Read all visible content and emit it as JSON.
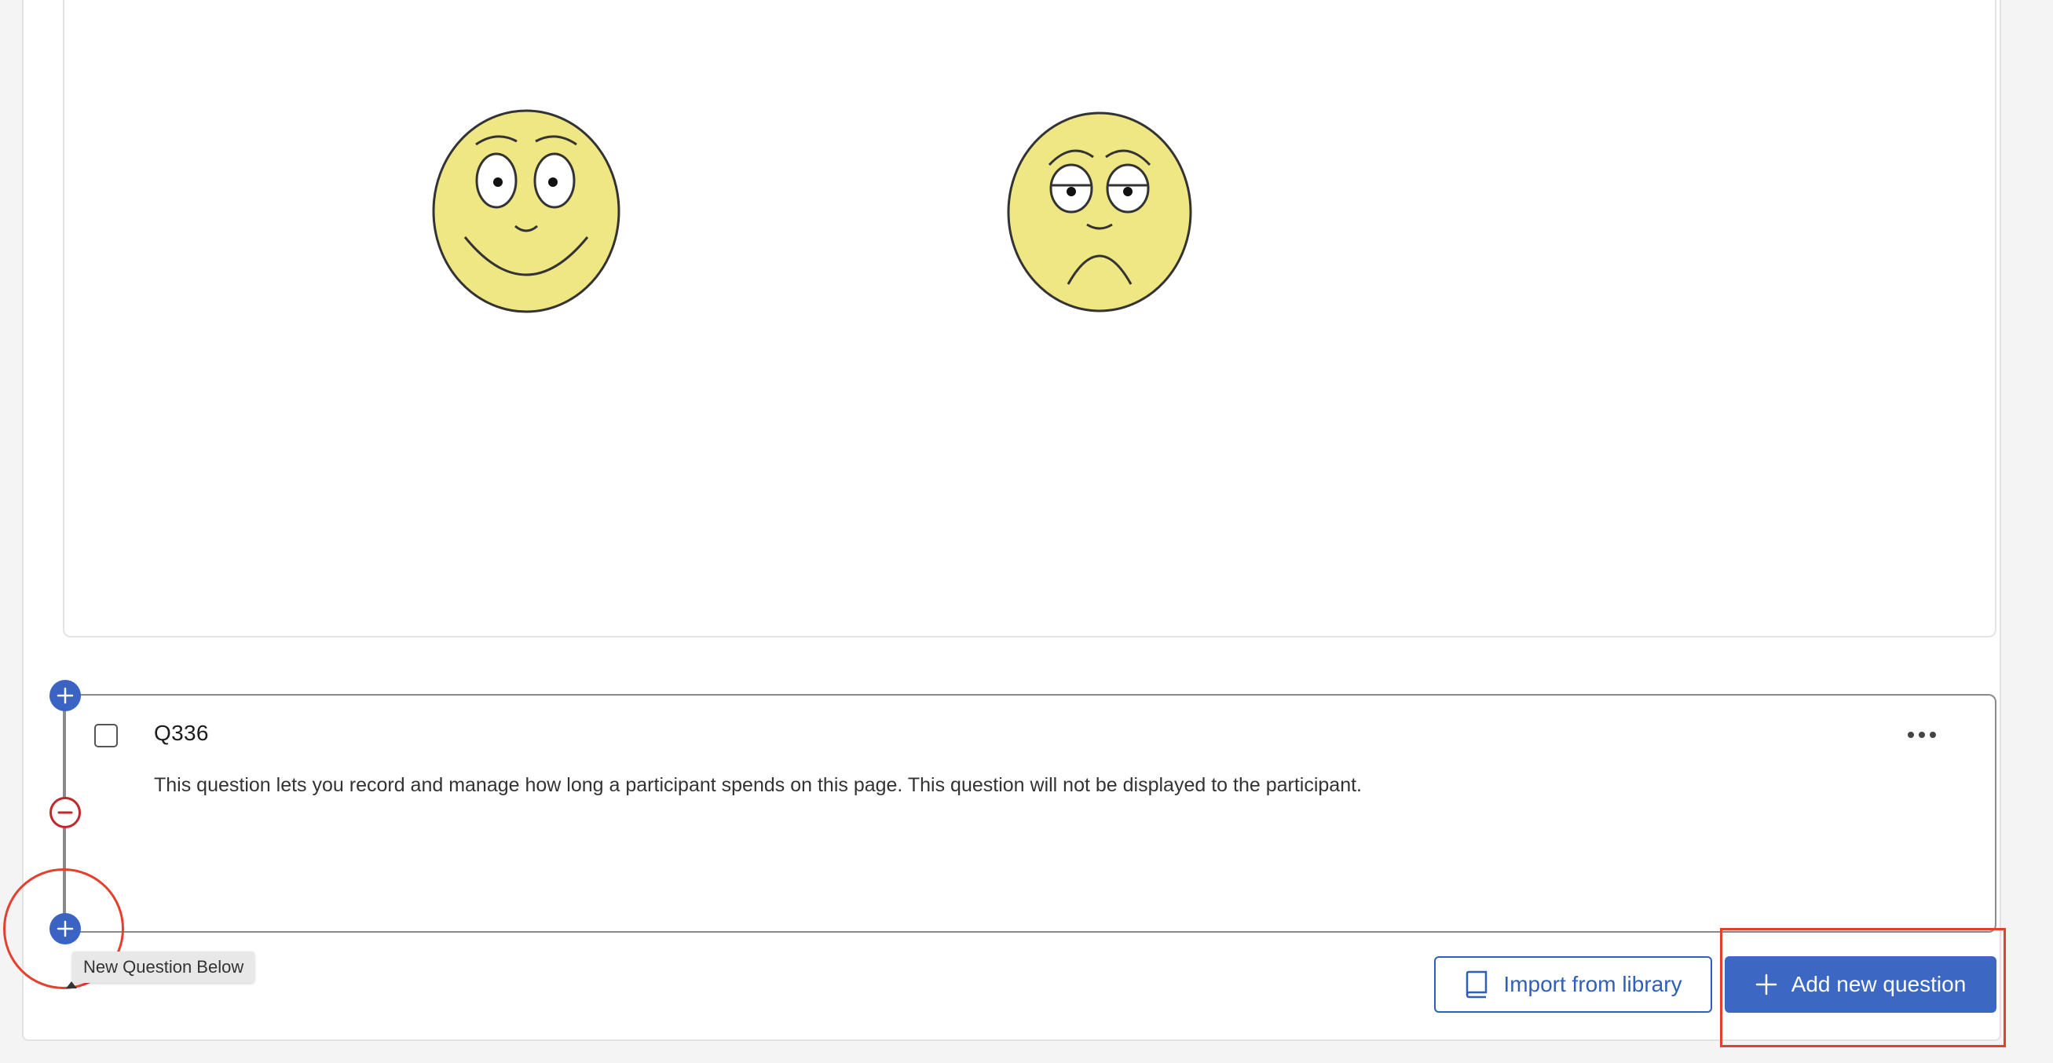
{
  "question": {
    "id": "Q336",
    "description": "This question lets you record and manage how long a participant spends on this page. This question will not be displayed to the participant."
  },
  "tooltip": {
    "text": "New Question Below"
  },
  "footer": {
    "import_label": "Import from library",
    "add_label": "Add new question"
  },
  "icons": {
    "add_above": "plus-icon",
    "remove": "minus-icon",
    "add_below": "plus-icon",
    "more": "more-horizontal-icon",
    "library": "book-icon",
    "add": "plus-icon",
    "face_happy": "happy-face-icon",
    "face_sad": "sad-face-icon"
  },
  "colors": {
    "primary": "#3c68c4",
    "danger": "#c0282f",
    "annotation": "#e3412d",
    "face_fill": "#efe784"
  }
}
